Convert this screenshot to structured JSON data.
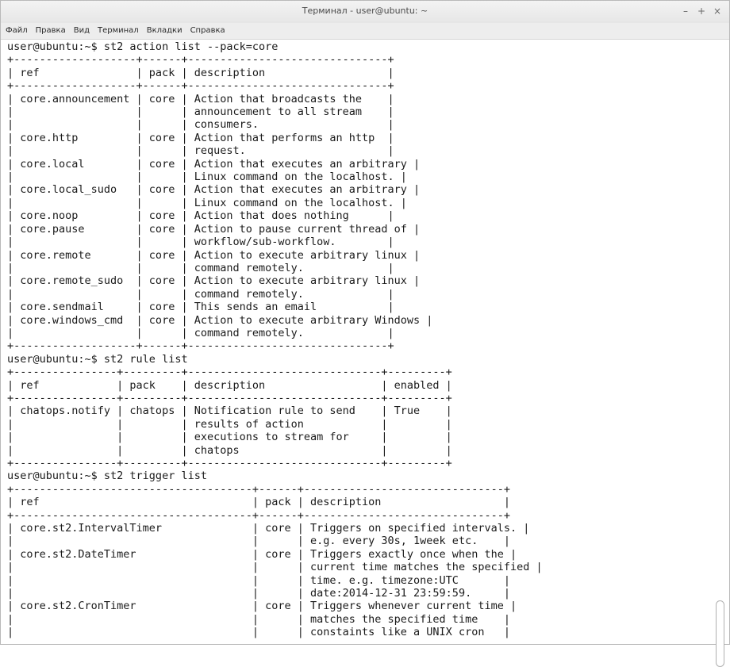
{
  "window": {
    "title": "Терминал - user@ubuntu: ~"
  },
  "controls": {
    "minimize": "–",
    "maximize": "+",
    "close": "×"
  },
  "menu": [
    "Файл",
    "Правка",
    "Вид",
    "Терминал",
    "Вкладки",
    "Справка"
  ],
  "terminal_lines": [
    "user@ubuntu:~$ st2 action list --pack=core",
    "+-------------------+------+-------------------------------+",
    "| ref               | pack | description                   |",
    "+-------------------+------+-------------------------------+",
    "| core.announcement | core | Action that broadcasts the    |",
    "|                   |      | announcement to all stream    |",
    "|                   |      | consumers.                    |",
    "| core.http         | core | Action that performs an http  |",
    "|                   |      | request.                      |",
    "| core.local        | core | Action that executes an arbitrary |",
    "|                   |      | Linux command on the localhost. |",
    "| core.local_sudo   | core | Action that executes an arbitrary |",
    "|                   |      | Linux command on the localhost. |",
    "| core.noop         | core | Action that does nothing      |",
    "| core.pause        | core | Action to pause current thread of |",
    "|                   |      | workflow/sub-workflow.        |",
    "| core.remote       | core | Action to execute arbitrary linux |",
    "|                   |      | command remotely.             |",
    "| core.remote_sudo  | core | Action to execute arbitrary linux |",
    "|                   |      | command remotely.             |",
    "| core.sendmail     | core | This sends an email           |",
    "| core.windows_cmd  | core | Action to execute arbitrary Windows |",
    "|                   |      | command remotely.             |",
    "+-------------------+------+-------------------------------+",
    "user@ubuntu:~$ st2 rule list",
    "+----------------+---------+------------------------------+---------+",
    "| ref            | pack    | description                  | enabled |",
    "+----------------+---------+------------------------------+---------+",
    "| chatops.notify | chatops | Notification rule to send    | True    |",
    "|                |         | results of action            |         |",
    "|                |         | executions to stream for     |         |",
    "|                |         | chatops                      |         |",
    "+----------------+---------+------------------------------+---------+",
    "user@ubuntu:~$ st2 trigger list",
    "+-------------------------------------+------+-------------------------------+",
    "| ref                                 | pack | description                   |",
    "+-------------------------------------+------+-------------------------------+",
    "| core.st2.IntervalTimer              | core | Triggers on specified intervals. |",
    "|                                     |      | e.g. every 30s, 1week etc.    |",
    "| core.st2.DateTimer                  | core | Triggers exactly once when the |",
    "|                                     |      | current time matches the specified |",
    "|                                     |      | time. e.g. timezone:UTC       |",
    "|                                     |      | date:2014-12-31 23:59:59.     |",
    "| core.st2.CronTimer                  | core | Triggers whenever current time |",
    "|                                     |      | matches the specified time    |",
    "|                                     |      | constaints like a UNIX cron   |"
  ]
}
